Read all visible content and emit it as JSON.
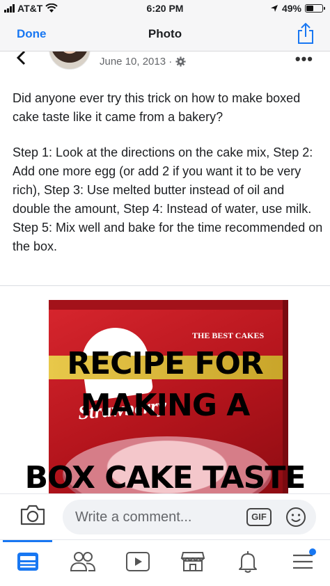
{
  "status_bar": {
    "carrier": "AT&T",
    "time": "6:20 PM",
    "battery": "49%",
    "battery_level": 0.49
  },
  "nav": {
    "done": "Done",
    "title": "Photo"
  },
  "post": {
    "date": "June 10, 2013 ·",
    "intro": "Did anyone ever try this trick on how to make boxed cake taste like it came from a bakery?",
    "steps": "Step 1: Look at the directions on the cake mix, Step 2: Add one more egg (or add 2 if you want it to be very rich), Step 3: Use melted butter instead of oil and double the amount, Step 4: Instead of water, use milk. Step 5: Mix well and bake for the time recommended on the box."
  },
  "image": {
    "box_brand_tagline": "THE BEST CAKES",
    "box_flavor": "Strawberry",
    "overlay_line1": "RECIPE FOR",
    "overlay_line2": "MAKING A",
    "overlay_line3": "BOX CAKE TASTE"
  },
  "comment": {
    "placeholder": "Write a comment...",
    "gif": "GIF"
  },
  "tabs": [
    {
      "icon": "news-feed-icon",
      "active": true
    },
    {
      "icon": "friends-icon"
    },
    {
      "icon": "watch-icon"
    },
    {
      "icon": "marketplace-icon"
    },
    {
      "icon": "notifications-bell-icon"
    },
    {
      "icon": "menu-icon",
      "badge": true
    }
  ],
  "colors": {
    "accent": "#1877f2",
    "box_red": "#c41a22"
  }
}
